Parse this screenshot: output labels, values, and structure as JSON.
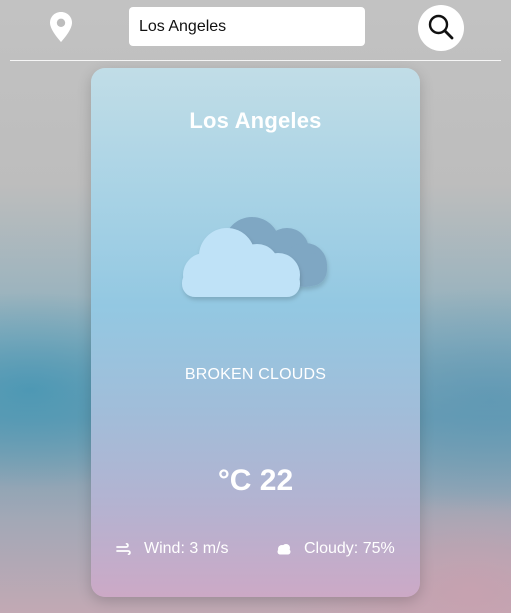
{
  "search": {
    "value": "Los Angeles",
    "location_icon": "map-pin-icon",
    "search_icon": "magnifier-icon"
  },
  "weather": {
    "city": "Los Angeles",
    "condition_icon": "broken-clouds-icon",
    "description": "BROKEN CLOUDS",
    "temperature": "°C 22",
    "wind": {
      "icon": "wind-icon",
      "label": "Wind: 3 m/s"
    },
    "cloudiness": {
      "icon": "cloud-icon",
      "label": "Cloudy: 75%"
    }
  },
  "colors": {
    "card_top": "#c1dde7",
    "card_bottom": "#cca9c6",
    "cloud_front": "#bfe2f7",
    "cloud_back": "#7fa7c3"
  }
}
